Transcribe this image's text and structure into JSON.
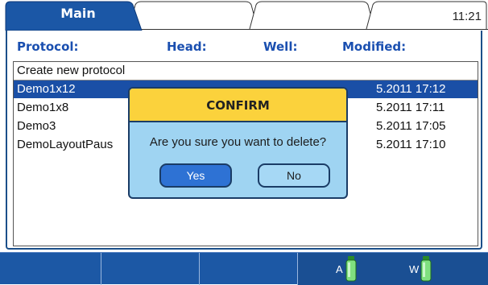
{
  "tabs": [
    {
      "label": "Main",
      "active": true
    },
    {
      "label": "",
      "active": false
    },
    {
      "label": "",
      "active": false
    },
    {
      "label": "",
      "active": false
    }
  ],
  "clock": "11:21",
  "columns": {
    "protocol": "Protocol:",
    "head": "Head:",
    "well": "Well:",
    "modified": "Modified:"
  },
  "rows": [
    {
      "name": "Create new protocol",
      "modified": ""
    },
    {
      "name": "Demo1x12",
      "modified": "5.2011 17:12",
      "selected": true
    },
    {
      "name": "Demo1x8",
      "modified": "5.2011 17:11"
    },
    {
      "name": "Demo3",
      "modified": "5.2011 17:05"
    },
    {
      "name": "DemoLayoutPaus",
      "modified": "5.2011 17:10"
    }
  ],
  "dialog": {
    "title": "CONFIRM",
    "message": "Are you sure you want to delete?",
    "yes": "Yes",
    "no": "No"
  },
  "bottles": [
    {
      "label": "A",
      "icon": "bottle-icon"
    },
    {
      "label": "W",
      "icon": "bottle-icon"
    }
  ],
  "colors": {
    "accent": "#1a4fa6",
    "dialog_bg": "#9fd4f2",
    "dialog_title_bg": "#fbd23c",
    "header_text": "#1a4fb0"
  }
}
